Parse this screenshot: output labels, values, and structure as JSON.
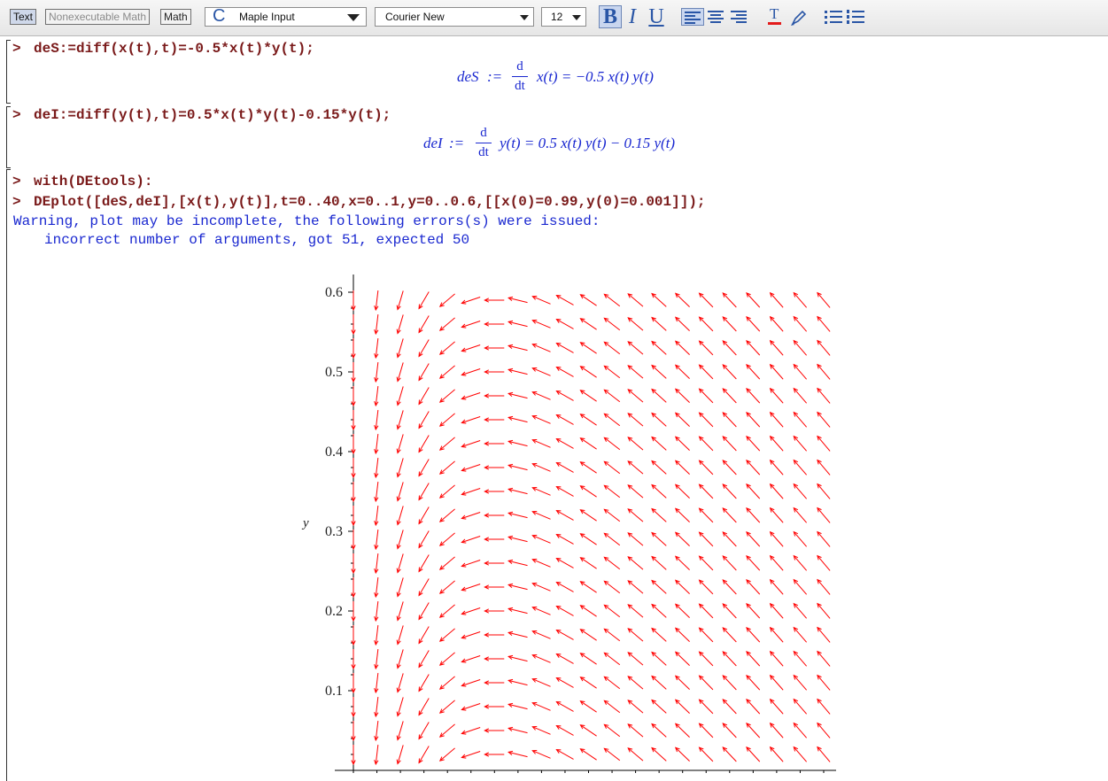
{
  "toolbar": {
    "mode_buttons": [
      "Text",
      "Nonexecutable Math",
      "Math"
    ],
    "style_selector": {
      "glyph": "C",
      "value": "Maple Input"
    },
    "font_selector": {
      "value": "Courier New"
    },
    "size_selector": {
      "value": "12"
    },
    "format": {
      "bold": "B",
      "italic": "I",
      "underline": "U"
    },
    "text_color_glyph": "T",
    "icons": [
      "align-left-icon",
      "align-center-icon",
      "align-right-icon",
      "text-color-icon",
      "highlight-icon",
      "bullet-list-icon",
      "numbered-list-icon"
    ]
  },
  "worksheet": {
    "prompt_symbol": ">",
    "group1": {
      "input": "deS:=diff(x(t),t)=-0.5*x(t)*y(t);",
      "output": {
        "lhs": "deS",
        "assign": ":=",
        "d": "d",
        "dt": "dt",
        "rhs": "x(t) = −0.5 x(t) y(t)"
      }
    },
    "group2": {
      "input": "deI:=diff(y(t),t)=0.5*x(t)*y(t)-0.15*y(t);",
      "output": {
        "lhs": "deI",
        "assign": ":=",
        "d": "d",
        "dt": "dt",
        "rhs": "y(t) = 0.5 x(t) y(t) − 0.15 y(t)"
      }
    },
    "group3": {
      "input1": "with(DEtools):",
      "input2": "DEplot([deS,deI],[x(t),y(t)],t=0..40,x=0..1,y=0..0.6,[[x(0)=0.99,y(0)=0.001]]);",
      "warning_line1": "Warning, plot may be incomplete, the following errors(s) were issued:",
      "warning_line2": "incorrect number of arguments, got 51, expected 50"
    }
  },
  "chart_data": {
    "type": "vector_field",
    "title": "",
    "xlabel": "",
    "ylabel": "y",
    "xlim": [
      0,
      1
    ],
    "ylim": [
      0,
      0.6
    ],
    "y_ticks": [
      "0.1",
      "0.2",
      "0.3",
      "0.4",
      "0.5",
      "0.6"
    ],
    "system": {
      "dx_dt": "-0.5*x*y",
      "dy_dt": "0.5*x*y - 0.15*y"
    },
    "x_samples": [
      0.0,
      0.05,
      0.1,
      0.15,
      0.2,
      0.25,
      0.3,
      0.35,
      0.4,
      0.45,
      0.5,
      0.55,
      0.6,
      0.65,
      0.7,
      0.75,
      0.8,
      0.85,
      0.9,
      0.95,
      1.0
    ],
    "y_samples": [
      0.02,
      0.05,
      0.08,
      0.11,
      0.14,
      0.17,
      0.2,
      0.23,
      0.26,
      0.29,
      0.32,
      0.35,
      0.38,
      0.41,
      0.44,
      0.47,
      0.5,
      0.53,
      0.56,
      0.59
    ],
    "arrow_color": "#ff0000",
    "grid": false
  }
}
